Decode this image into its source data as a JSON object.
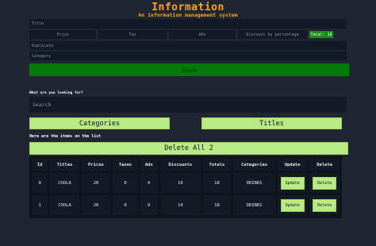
{
  "header": {
    "title": "Information",
    "subtitle": "An information management system"
  },
  "form": {
    "title_placeholder": "Title",
    "price_placeholder": "Price",
    "tax_placeholder": "Tax",
    "ads_placeholder": "Ads",
    "discount_placeholder": "Discount by percentage",
    "total_label": "Total: 18",
    "duplicate_placeholder": "Duplicate",
    "category_placeholder": "Category",
    "save_label": "Save"
  },
  "search": {
    "label": "What are you looking for?",
    "placeholder": "Search",
    "by_categories_label": "Categories",
    "by_titles_label": "Titles"
  },
  "list": {
    "label": "Here are the items on the list",
    "delete_all_label": "Delete All 2"
  },
  "table": {
    "headers": [
      "Id",
      "Titles",
      "Prices",
      "Taxes",
      "Ads",
      "Discounts",
      "Totals",
      "Categories",
      "Update",
      "Delete"
    ],
    "rows": [
      {
        "id": "0",
        "title": "COOLA",
        "price": "20",
        "tax": "0",
        "ads": "0",
        "discount": "10",
        "total": "18",
        "category": "DRINKS",
        "update": "Update",
        "delete": "Delete"
      },
      {
        "id": "1",
        "title": "COOLA",
        "price": "20",
        "tax": "0",
        "ads": "0",
        "discount": "10",
        "total": "18",
        "category": "DRINKS",
        "update": "Update",
        "delete": "Delete"
      }
    ]
  },
  "colors": {
    "background": "#202531",
    "accent_orange": "#f5a623",
    "save_green": "#067a06",
    "light_green": "#b9ea84",
    "input_bg": "#141925"
  }
}
